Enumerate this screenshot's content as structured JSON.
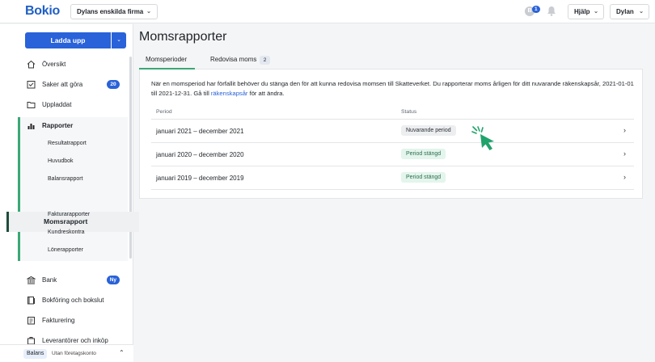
{
  "topbar": {
    "logo": "Bokio",
    "company": "Dylans enskilda firma",
    "coin_badge": "1",
    "help": "Hjälp",
    "user": "Dylan"
  },
  "sidebar": {
    "upload_label": "Ladda upp",
    "items": [
      {
        "label": "Översikt",
        "icon": "home-icon"
      },
      {
        "label": "Saker att göra",
        "icon": "todo-icon",
        "badge": "20"
      },
      {
        "label": "Uppladdat",
        "icon": "folder-icon"
      },
      {
        "label": "Rapporter",
        "icon": "chart-icon"
      },
      {
        "label": "Bank",
        "icon": "bank-icon",
        "badge": "Ny"
      },
      {
        "label": "Bokföring och bokslut",
        "icon": "book-icon"
      },
      {
        "label": "Fakturering",
        "icon": "invoice-icon"
      },
      {
        "label": "Leverantörer och inköp",
        "icon": "supplier-icon"
      }
    ],
    "subitems": [
      "Resultatrapport",
      "Huvudbok",
      "Balansrapport",
      "Momsrapport",
      "Fakturarapporter",
      "Kundreskontra",
      "Lönerapporter"
    ],
    "balans_label": "Balans",
    "balans_sub": "Utan företagskonto"
  },
  "main": {
    "title": "Momsrapporter",
    "tabs": [
      {
        "label": "Momsperioder"
      },
      {
        "label": "Redovisa moms",
        "count": "2"
      }
    ],
    "intro_text": "När en momsperiod har förfallit behöver du stänga den för att kunna redovisa momsen till Skatteverket. Du rapporterar moms årligen för ditt nuvarande räkenskapsår, 2021-01-01 till 2021-12-31. Gå till ",
    "intro_link": "räkenskapsår",
    "intro_tail": " för att ändra.",
    "headers": {
      "period": "Period",
      "status": "Status"
    },
    "rows": [
      {
        "period": "januari 2021 – december 2021",
        "status": "Nuvarande period"
      },
      {
        "period": "januari 2020 – december 2020",
        "status": "Period stängd"
      },
      {
        "period": "januari 2019 – december 2019",
        "status": "Period stängd"
      }
    ]
  },
  "colors": {
    "brand_blue": "#2962d9",
    "accent_green": "#3ba776"
  }
}
